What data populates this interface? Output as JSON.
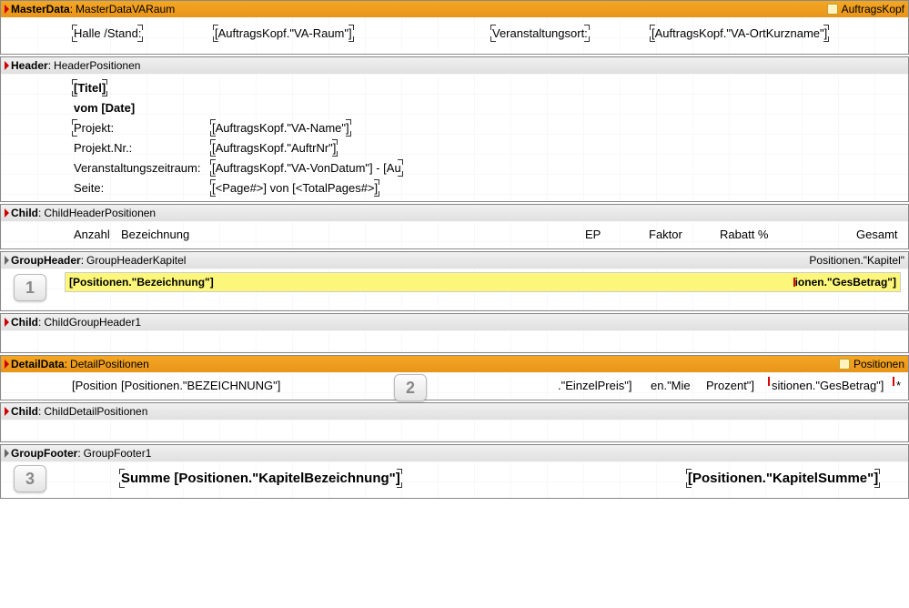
{
  "bands": {
    "masterData": {
      "typeLabel": "MasterData",
      "name": "MasterDataVARaum",
      "dataset": "AuftragsKopf",
      "fields": {
        "halleLabel": "Halle /Stand:",
        "halleExpr": "[AuftragsKopf.\"VA-Raum\"]",
        "ortLabel": "Veranstaltungsort:",
        "ortExpr": "[AuftragsKopf.\"VA-OrtKurzname\"]"
      }
    },
    "header": {
      "typeLabel": "Header",
      "name": "HeaderPositionen",
      "fields": {
        "titel": "[Titel]",
        "datum": "vom [Date]",
        "projektLabel": "Projekt:",
        "projektExpr": "[AuftragsKopf.\"VA-Name\"]",
        "projektNrLabel": "Projekt.Nr.:",
        "projektNrExpr": "[AuftragsKopf.\"AuftrNr\"]",
        "zeitraumLabel": "Veranstaltungszeitraum:",
        "zeitraumExpr": "[AuftragsKopf.\"VA-VonDatum\"] - [Au",
        "seiteLabel": "Seite:",
        "seiteExpr": "[<Page#>] von [<TotalPages#>]"
      }
    },
    "childHeader": {
      "typeLabel": "Child",
      "name": "ChildHeaderPositionen",
      "cols": {
        "anzahl": "Anzahl",
        "bezeichnung": "Bezeichnung",
        "ep": "EP",
        "faktor": "Faktor",
        "rabatt": "Rabatt %",
        "gesamt": "Gesamt"
      }
    },
    "groupHeader": {
      "typeLabel": "GroupHeader",
      "name": "GroupHeaderKapitel",
      "condition": "Positionen.\"Kapitel\"",
      "bezExpr": "[Positionen.\"Bezeichnung\"]",
      "gesExpr": "ionen.\"GesBetrag\"]"
    },
    "childGroupHeader": {
      "typeLabel": "Child",
      "name": "ChildGroupHeader1"
    },
    "detailData": {
      "typeLabel": "DetailData",
      "name": "DetailPositionen",
      "dataset": "Positionen",
      "fields": {
        "pos": "[Position",
        "bez": "[Positionen.\"BEZEICHNUNG\"]",
        "ep": ".\"EinzelPreis\"]",
        "miet": "en.\"Mie",
        "prozent": "Prozent\"]",
        "ges": "sitionen.\"GesBetrag\"]",
        "star": "*"
      }
    },
    "childDetail": {
      "typeLabel": "Child",
      "name": "ChildDetailPositionen"
    },
    "groupFooter": {
      "typeLabel": "GroupFooter",
      "name": "GroupFooter1",
      "summeLabel": "Summe [Positionen.\"KapitelBezeichnung\"]",
      "summeExpr": "[Positionen.\"KapitelSumme\"]"
    }
  },
  "badges": {
    "b1": "1",
    "b2": "2",
    "b3": "3"
  }
}
